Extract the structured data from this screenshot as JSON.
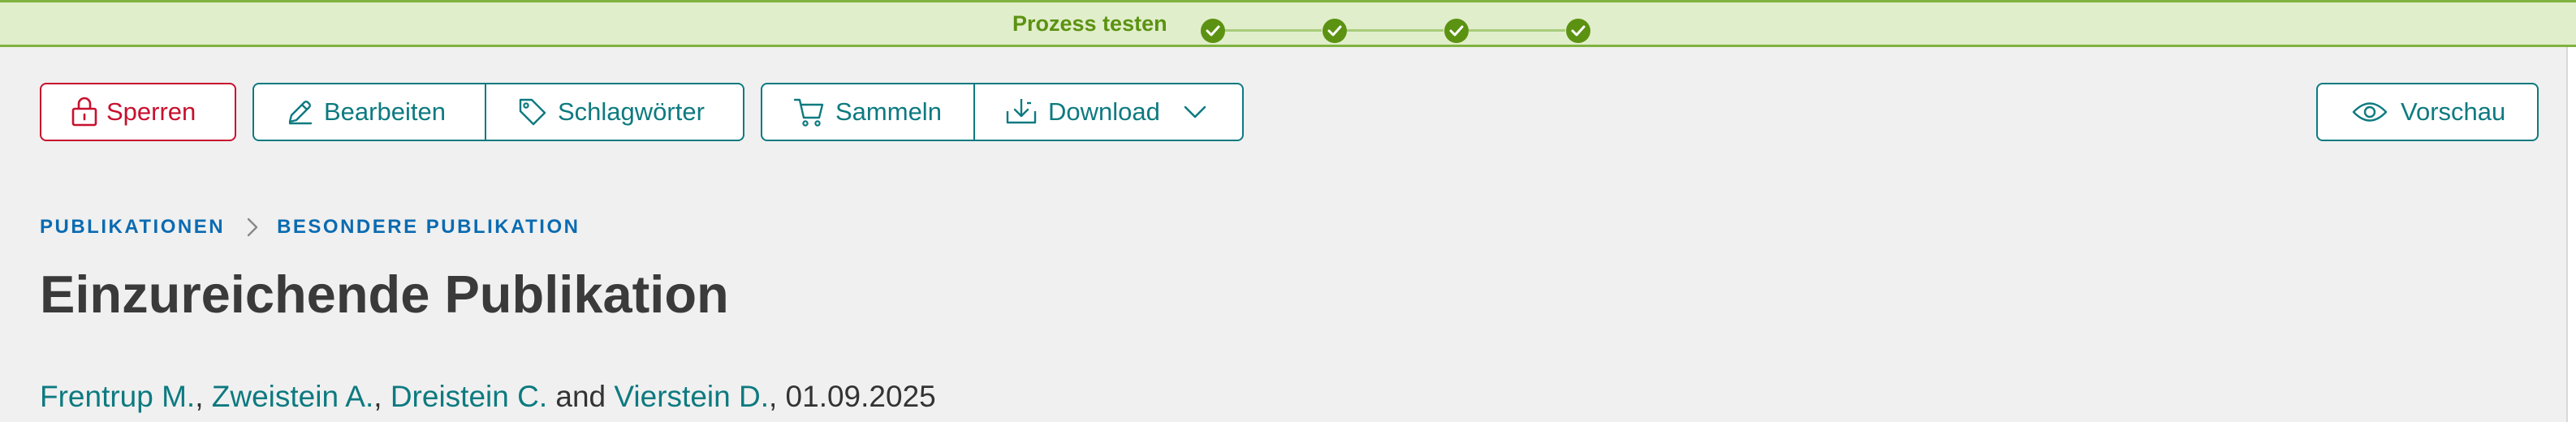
{
  "progress": {
    "label": "Prozess testen",
    "steps": [
      {
        "name": "step-1",
        "done": true
      },
      {
        "name": "step-2",
        "done": true
      },
      {
        "name": "step-3",
        "done": true
      },
      {
        "name": "step-4",
        "done": true
      }
    ],
    "color": "#5c9212"
  },
  "toolbar": {
    "lock_label": "Sperren",
    "edit_label": "Bearbeiten",
    "tags_label": "Schlagwörter",
    "collect_label": "Sammeln",
    "download_label": "Download",
    "preview_label": "Vorschau"
  },
  "breadcrumb": {
    "items": [
      "PUBLIKATIONEN",
      "BESONDERE PUBLIKATION"
    ]
  },
  "page": {
    "title": "Einzureichende Publikation"
  },
  "authors": {
    "names": [
      "Frentrup M.",
      "Zweistein A.",
      "Dreistein C.",
      "Vierstein D."
    ],
    "sep1": ", ",
    "sep2": ", ",
    "conjunction": " and ",
    "date_prefix": ", ",
    "date": "01.09.2025"
  },
  "colors": {
    "accent": "#0d7a80",
    "danger": "#c8102e",
    "link_blue": "#0a6bb1",
    "success": "#5c9212"
  },
  "icons": {
    "lock": "lock-icon",
    "edit": "pencil-icon",
    "tags": "tag-icon",
    "collect": "cart-icon",
    "download": "download-icon",
    "dropdown": "chevron-down-icon",
    "preview": "eye-icon"
  }
}
